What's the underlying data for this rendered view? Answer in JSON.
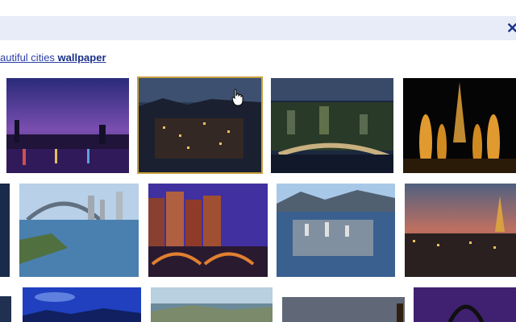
{
  "header": {
    "close_icon": "close-icon"
  },
  "suggestion": {
    "prefix": "autiful cities",
    "bold": "wallpaper"
  },
  "images": [
    {
      "id": "r1c1",
      "desc": "city skyline at dusk purple sky"
    },
    {
      "id": "r1c2",
      "desc": "coastal city at night from hill"
    },
    {
      "id": "r1c3",
      "desc": "city bridges aerial night"
    },
    {
      "id": "r1c4",
      "desc": "paris eiffel tower fountains night"
    },
    {
      "id": "r2c0",
      "desc": "partial city night"
    },
    {
      "id": "r2c1",
      "desc": "sydney harbour bridge"
    },
    {
      "id": "r2c2",
      "desc": "amsterdam canal houses night"
    },
    {
      "id": "r2c3",
      "desc": "vancouver aerial day"
    },
    {
      "id": "r2c4",
      "desc": "paris eiffel tower sunset"
    },
    {
      "id": "r3c0",
      "desc": "partial city"
    },
    {
      "id": "r3c1",
      "desc": "blue sky city"
    },
    {
      "id": "r3c2",
      "desc": "coastal aerial"
    },
    {
      "id": "r3c3",
      "desc": "cloudy skyline"
    },
    {
      "id": "r3c4",
      "desc": "st louis arch"
    }
  ]
}
